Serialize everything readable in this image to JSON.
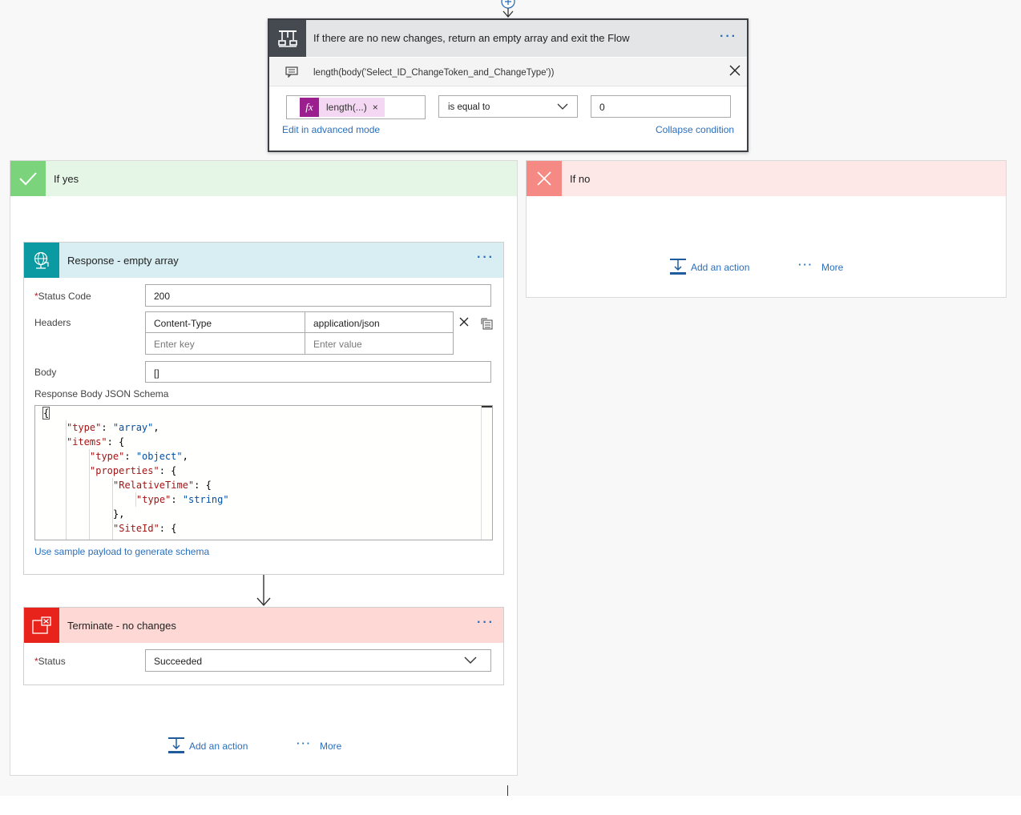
{
  "condition": {
    "title": "If there are no new changes, return an empty array and exit the Flow",
    "more": "···",
    "expression": "length(body('Select_ID_ChangeToken_and_ChangeType'))",
    "token_fx": "fx",
    "token_label": "length(...)",
    "token_remove": "×",
    "operator": "is equal to",
    "value": "0",
    "edit_advanced": "Edit in advanced mode",
    "collapse": "Collapse condition"
  },
  "yes_branch": {
    "title": "If yes",
    "add_action": "Add an action",
    "more_dots": "···",
    "more": "More"
  },
  "no_branch": {
    "title": "If no",
    "add_action": "Add an action",
    "more_dots": "···",
    "more": "More"
  },
  "response": {
    "title": "Response - empty array",
    "more": "···",
    "status_required": "*",
    "status_label": "Status Code",
    "status_value": "200",
    "headers_label": "Headers",
    "header_key": "Content-Type",
    "header_value": "application/json",
    "key_placeholder": "Enter key",
    "value_placeholder": "Enter value",
    "body_label": "Body",
    "body_value": "[]",
    "schema_label": "Response Body JSON Schema",
    "schema_lines": [
      "{",
      "\"type\": \"array\",",
      "\"items\": {",
      "\"type\": \"object\",",
      "\"properties\": {",
      "\"RelativeTime\": {",
      "\"type\": \"string\"",
      "},",
      "\"SiteId\": {"
    ],
    "sample_payload": "Use sample payload to generate schema"
  },
  "terminate": {
    "title": "Terminate - no changes",
    "more": "···",
    "status_required": "*",
    "status_label": "Status",
    "status_value": "Succeeded"
  },
  "colors": {
    "accent": "#2a6ebb",
    "condition_header": "#454a50",
    "yes": "#7bd37b",
    "no": "#f58a84",
    "response": "#0b9aa1",
    "terminate": "#e8231b",
    "expression_token": "#9c1f8f"
  }
}
